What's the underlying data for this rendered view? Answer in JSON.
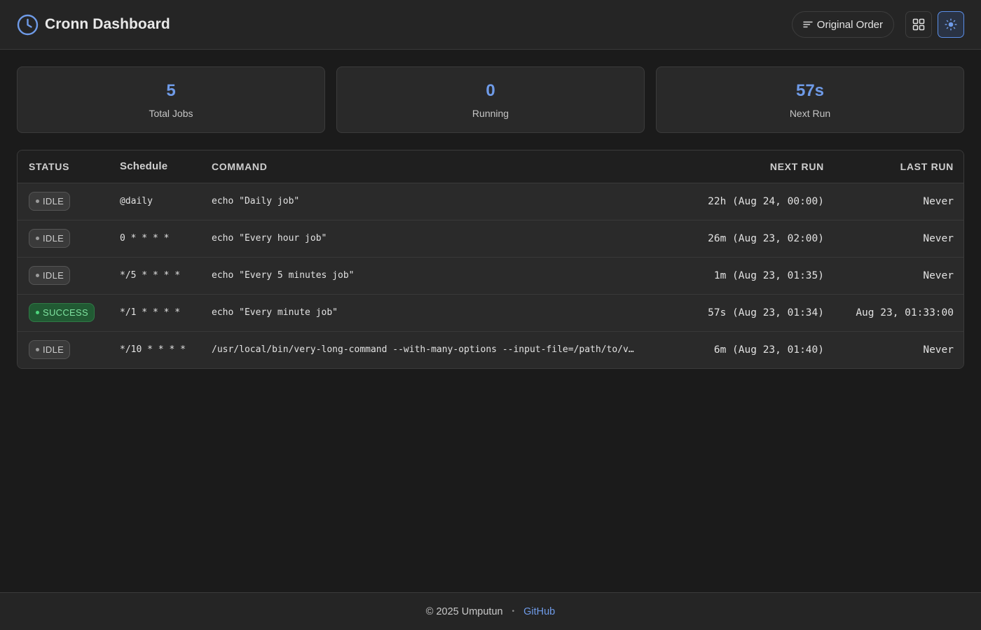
{
  "header": {
    "title": "Cronn Dashboard",
    "sort_label": "Original Order",
    "logo_icon": "clock-icon",
    "layout_icon": "grid-icon",
    "theme_icon": "sun-icon"
  },
  "stats": [
    {
      "value": "5",
      "label": "Total Jobs"
    },
    {
      "value": "0",
      "label": "Running"
    },
    {
      "value": "57s",
      "label": "Next Run"
    }
  ],
  "table": {
    "columns": [
      "STATUS",
      "Schedule",
      "COMMAND",
      "NEXT RUN",
      "LAST RUN"
    ],
    "rows": [
      {
        "status": "IDLE",
        "schedule": "@daily",
        "command": "echo \"Daily job\"",
        "next_run": "22h (Aug 24, 00:00)",
        "last_run": "Never"
      },
      {
        "status": "IDLE",
        "schedule": "0 * * * *",
        "command": "echo \"Every hour job\"",
        "next_run": "26m (Aug 23, 02:00)",
        "last_run": "Never"
      },
      {
        "status": "IDLE",
        "schedule": "*/5 * * * *",
        "command": "echo \"Every 5 minutes job\"",
        "next_run": "1m (Aug 23, 01:35)",
        "last_run": "Never"
      },
      {
        "status": "SUCCESS",
        "schedule": "*/1 * * * *",
        "command": "echo \"Every minute job\"",
        "next_run": "57s (Aug 23, 01:34)",
        "last_run": "Aug 23, 01:33:00"
      },
      {
        "status": "IDLE",
        "schedule": "*/10 * * * *",
        "command": "/usr/local/bin/very-long-command --with-many-options --input-file=/path/to/very/...",
        "next_run": "6m (Aug 23, 01:40)",
        "last_run": "Never"
      }
    ]
  },
  "footer": {
    "copyright": "© 2025 Umputun",
    "separator": "•",
    "link_label": "GitHub"
  },
  "colors": {
    "accent": "#6f9be8",
    "background": "#1b1b1b",
    "success": "#4fd67e",
    "idle": "#9b9b9b"
  }
}
